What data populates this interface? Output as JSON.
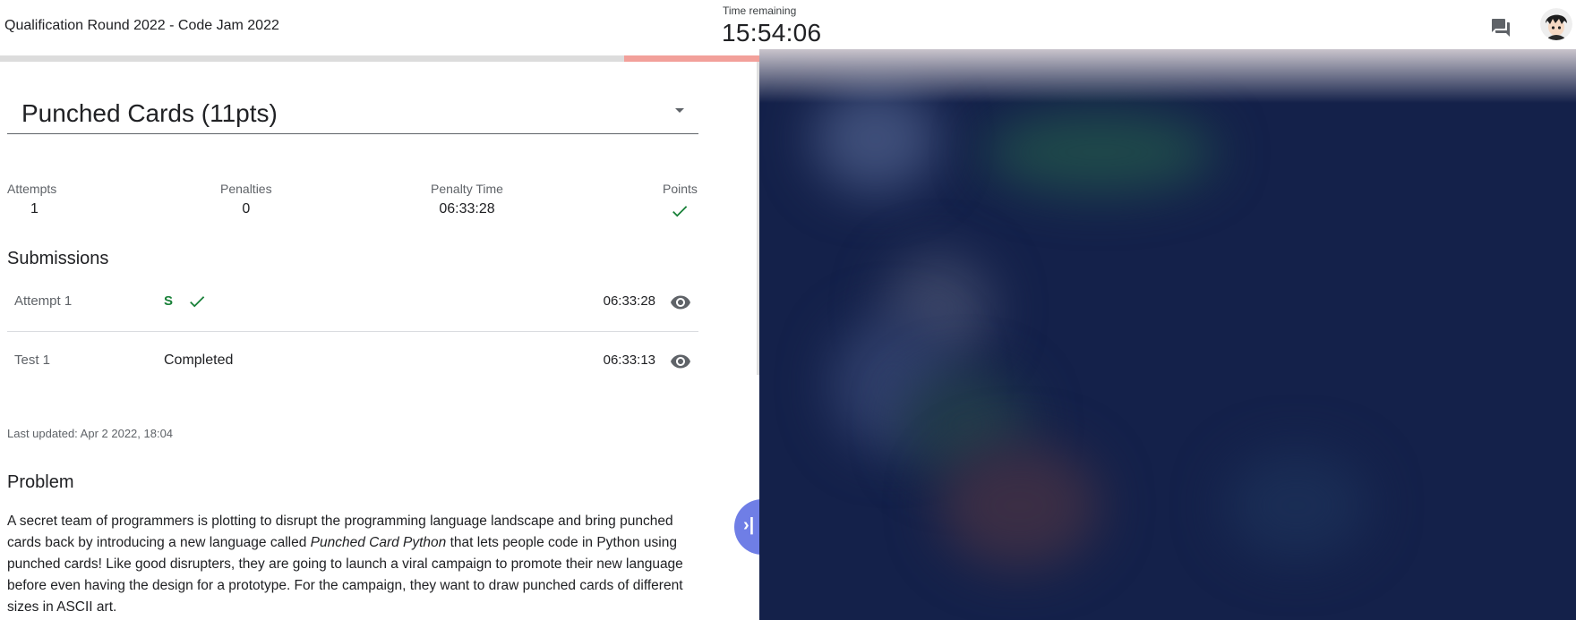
{
  "header": {
    "contest_title": "Qualification Round 2022 - Code Jam 2022",
    "timer_label": "Time remaining",
    "timer_value": "15:54:06",
    "chat_icon": "chat-icon",
    "avatar_icon": "avatar"
  },
  "progress": {
    "elapsed_fraction": 0.18
  },
  "problem": {
    "title": "Punched Cards (11pts)",
    "dropdown_icon": "chevron-down-icon"
  },
  "stats": {
    "attempts_label": "Attempts",
    "attempts_value": "1",
    "penalties_label": "Penalties",
    "penalties_value": "0",
    "penalty_time_label": "Penalty Time",
    "penalty_time_value": "06:33:28",
    "points_label": "Points",
    "points_icon": "check-icon"
  },
  "submissions": {
    "heading": "Submissions",
    "rows": [
      {
        "name": "Attempt 1",
        "verdict": "S",
        "verdict_icon": "check-icon",
        "time": "06:33:28",
        "view_icon": "eye-icon"
      },
      {
        "name": "Test 1",
        "status": "Completed",
        "time": "06:33:13",
        "view_icon": "eye-icon"
      }
    ]
  },
  "last_updated": "Last updated: Apr 2 2022, 18:04",
  "problem_section": {
    "heading": "Problem",
    "text_1": "A secret team of programmers is plotting to disrupt the programming language landscape and bring punched cards back by introducing a new language called ",
    "text_em": "Punched Card Python",
    "text_2": " that lets people code in Python using punched cards! Like good disrupters, they are going to launch a viral campaign to promote their new language before even having the design for a prototype. For the campaign, they want to draw punched cards of different sizes in ASCII art."
  },
  "panel_toggle_icon": "collapse-panel-icon",
  "colors": {
    "accent_green": "#188038",
    "progress_fill": "#f2a09a",
    "toggle_button": "#6f7ee6",
    "blurred_panel": "#14214a"
  }
}
